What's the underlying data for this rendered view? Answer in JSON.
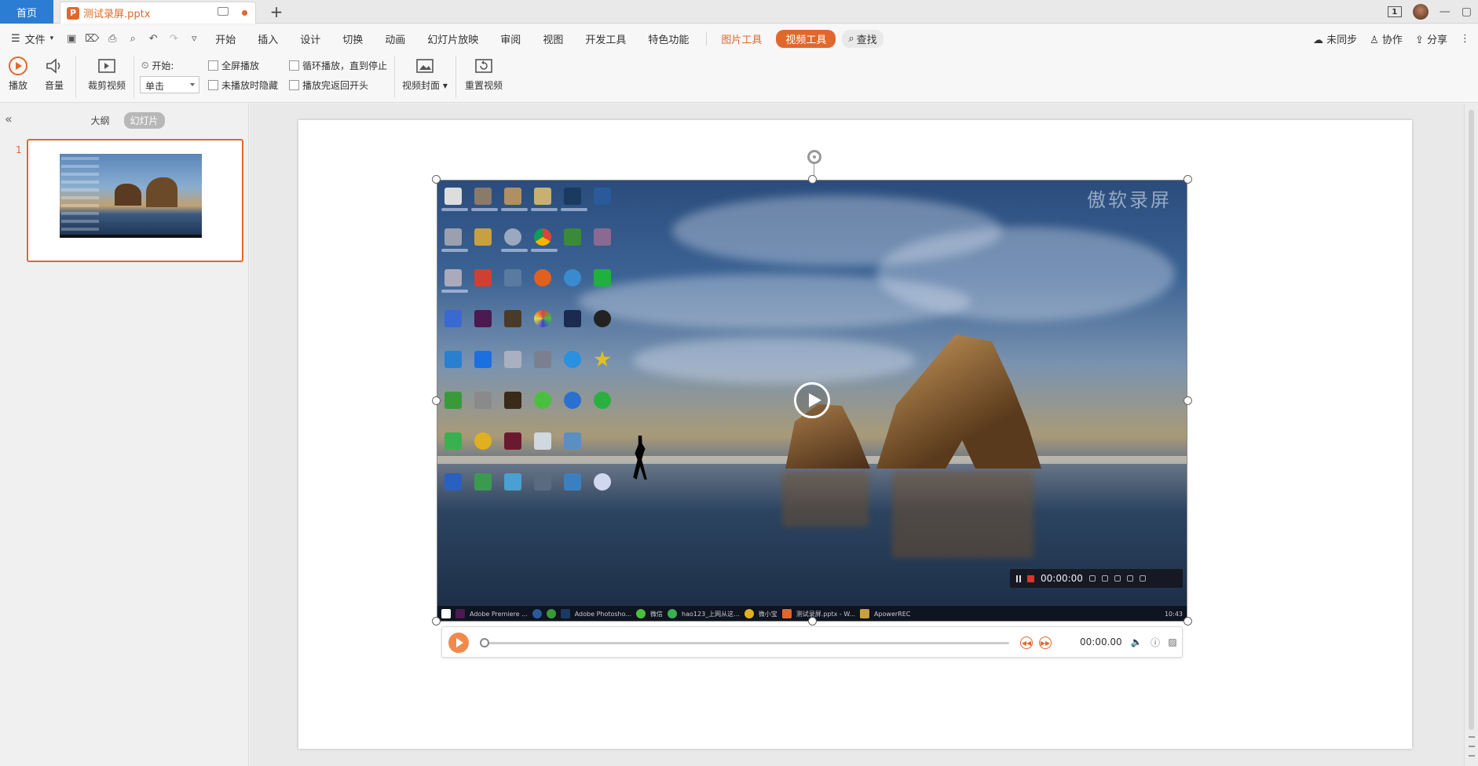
{
  "window": {
    "home_tab": "首页",
    "doc_tab": "测试录屏.pptx",
    "new_tab": "+",
    "slide_count_badge": "1",
    "min": "—",
    "max": "▢"
  },
  "menu": {
    "file": "文件",
    "items": [
      "开始",
      "插入",
      "设计",
      "切换",
      "动画",
      "幻灯片放映",
      "审阅",
      "视图",
      "开发工具",
      "特色功能"
    ],
    "picture_tool": "图片工具",
    "video_tool": "视频工具",
    "search": "查找",
    "sync": "未同步",
    "collab": "协作",
    "share": "分享"
  },
  "ribbon": {
    "play": "播放",
    "volume": "音量",
    "trim": "裁剪视频",
    "start_label": "开始:",
    "start_value": "单击",
    "fullscreen": "全屏播放",
    "hide_not_playing": "未播放时隐藏",
    "loop": "循环播放，直到停止",
    "rewind": "播放完返回开头",
    "cover": "视频封面",
    "reset": "重置视频"
  },
  "sidebar": {
    "tab_outline": "大纲",
    "tab_slides": "幻灯片",
    "slide_number": "1"
  },
  "video": {
    "watermark": "傲软录屏",
    "rec_time": "00:00:00",
    "taskbar": [
      "Adobe Premiere ...",
      "Adobe Photosho...",
      "微信",
      "hao123_上网从这...",
      "微小宝",
      "测试录屏.pptx - W...",
      "ApowerREC"
    ],
    "clock": "10:43"
  },
  "player": {
    "time": "00:00.00",
    "progress": 0
  },
  "colors": {
    "accent": "#e0682c",
    "home_blue": "#2b7cd3"
  }
}
